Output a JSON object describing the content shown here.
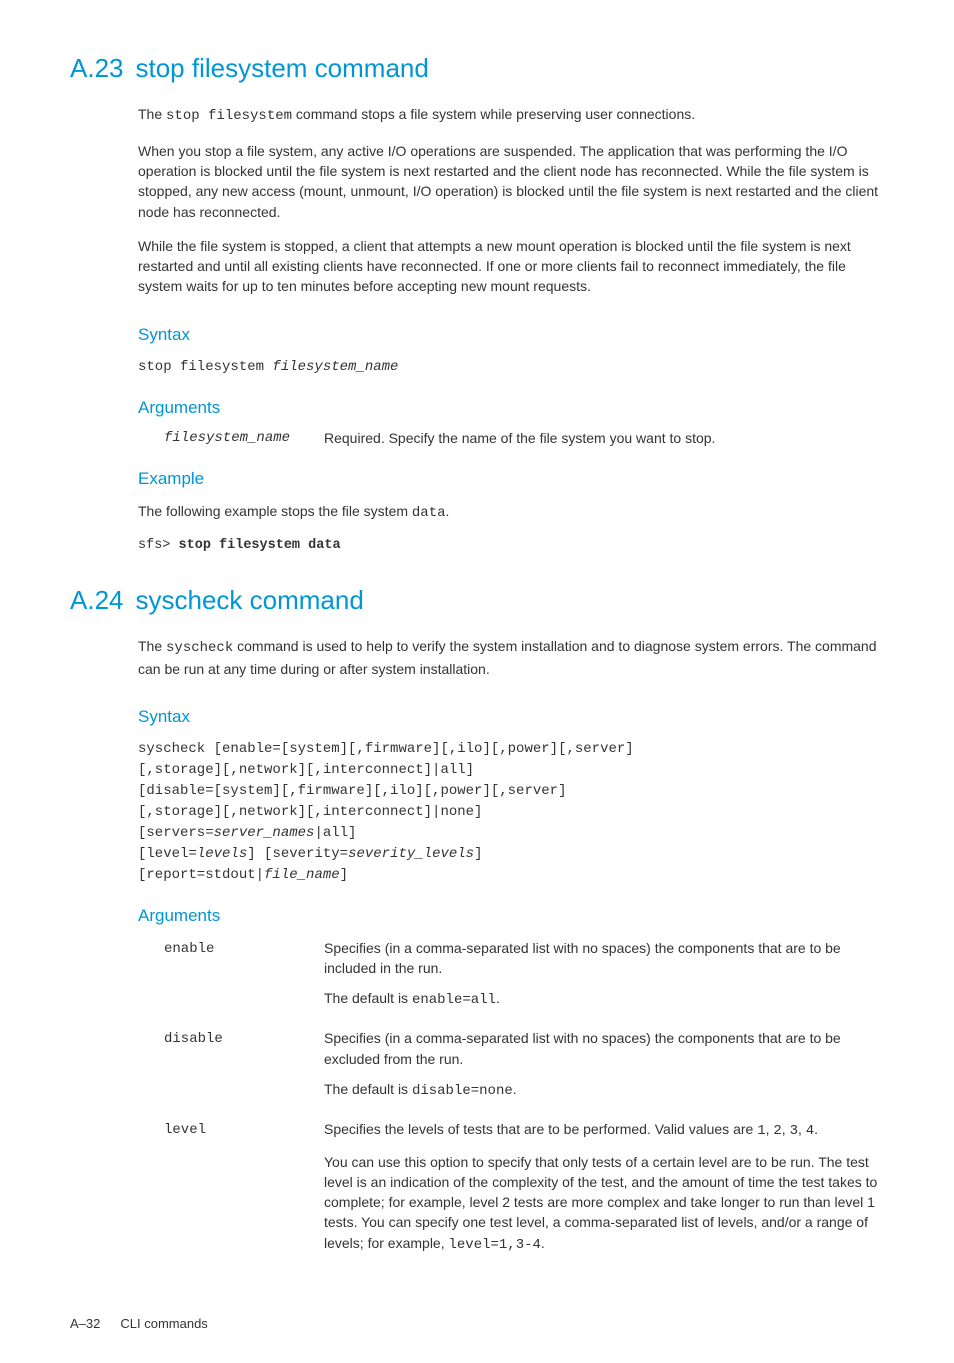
{
  "sec23": {
    "num": "A.23",
    "title": "stop filesystem command",
    "intro_pre": "The ",
    "intro_cmd": "stop filesystem",
    "intro_post": " command stops a file system while preserving user connections.",
    "p2": "When you stop a file system, any active I/O operations are suspended. The application that was performing the I/O operation is blocked until the file system is next restarted and the client node has reconnected. While the file system is stopped, any new access (mount, unmount, I/O operation) is blocked until the file system is next restarted and the client node has reconnected.",
    "p3": "While the file system is stopped, a client that attempts a new mount operation is blocked until the file system is next restarted and until all existing clients have reconnected. If one or more clients fail to reconnect immediately, the file system waits for up to ten minutes before accepting new mount requests.",
    "syntax_h": "Syntax",
    "syntax_cmd": "stop filesystem ",
    "syntax_arg": "filesystem_name",
    "args_h": "Arguments",
    "arg_name": "filesystem_name",
    "arg_desc": "Required. Specify the name of the file system you want to stop.",
    "example_h": "Example",
    "example_pre": "The following example stops the file system ",
    "example_code": "data",
    "example_post": ".",
    "example_prompt": "sfs> ",
    "example_cmd": "stop filesystem data"
  },
  "sec24": {
    "num": "A.24",
    "title": "syscheck command",
    "intro_pre": "The ",
    "intro_cmd": "syscheck",
    "intro_post": " command is used to help to verify the system installation and to diagnose system errors. The command can be run at any time during or after system installation.",
    "syntax_h": "Syntax",
    "syntax_l1": "syscheck [enable=[system][,firmware][,ilo][,power][,server]",
    "syntax_l2": "[,storage][,network][,interconnect]|all]",
    "syntax_l3": "[disable=[system][,firmware][,ilo][,power][,server]",
    "syntax_l4": "[,storage][,network][,interconnect]|none]",
    "syntax_l5a": "[servers=",
    "syntax_l5b": "server_names",
    "syntax_l5c": "|all]",
    "syntax_l6a": "[level=",
    "syntax_l6b": "levels",
    "syntax_l6c": "] [severity=",
    "syntax_l6d": "severity_levels",
    "syntax_l6e": "]",
    "syntax_l7a": "[report=stdout|",
    "syntax_l7b": "file_name",
    "syntax_l7c": "]",
    "args_h": "Arguments",
    "arg_enable": "enable",
    "arg_enable_d1": "Specifies (in a comma-separated list with no spaces) the components that are to be included in the run.",
    "arg_enable_d2a": "The default is ",
    "arg_enable_d2b": "enable=all",
    "arg_enable_d2c": ".",
    "arg_disable": "disable",
    "arg_disable_d1": "Specifies (in a comma-separated list with no spaces) the components that are to be excluded from the run.",
    "arg_disable_d2a": "The default is ",
    "arg_disable_d2b": "disable=none",
    "arg_disable_d2c": ".",
    "arg_level": "level",
    "arg_level_d1a": "Specifies the levels of tests that are to be performed. Valid values are ",
    "arg_level_d1b": "1",
    "arg_level_d1c": ", ",
    "arg_level_d1d": "2",
    "arg_level_d1e": ", ",
    "arg_level_d1f": "3",
    "arg_level_d1g": ", ",
    "arg_level_d1h": "4",
    "arg_level_d1i": ".",
    "arg_level_d2a": "You can use this option to specify that only tests of a certain level are to be run. The test level is an indication of the complexity of the test, and the amount of time the test takes to complete; for example, level 2 tests are more complex and take longer to run than level 1 tests. You can specify one test level, a comma-separated list of levels, and/or a range of levels; for example, ",
    "arg_level_d2b": "level=1,3-4",
    "arg_level_d2c": "."
  },
  "footer": {
    "page": "A–32",
    "title": "CLI commands"
  }
}
